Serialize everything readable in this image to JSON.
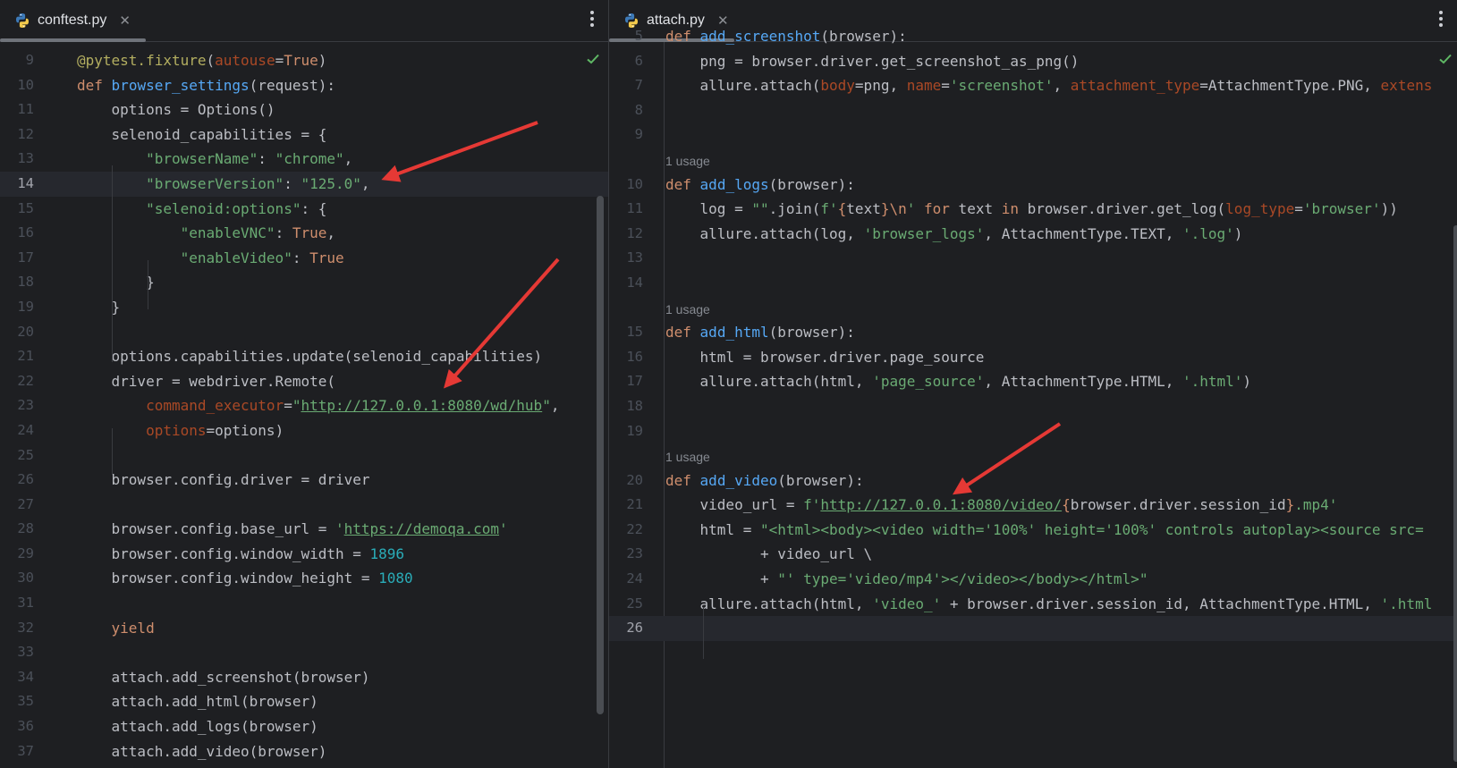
{
  "left_pane": {
    "tab": {
      "label": "conftest.py",
      "close": "✕"
    },
    "lines": [
      {
        "n": "9",
        "html": "<span class='dec'>@pytest.fixture</span>(<span class='ar'>autouse</span>=<span class='kw'>True</span>)"
      },
      {
        "n": "10",
        "html": "<span class='kw'>def</span> <span class='fn'>browser_settings</span>(request):"
      },
      {
        "n": "11",
        "html": "    options = Options()"
      },
      {
        "n": "12",
        "html": "    selenoid_capabilities = {"
      },
      {
        "n": "13",
        "html": "        <span class='st'>\"browserName\"</span>: <span class='st'>\"chrome\"</span>,"
      },
      {
        "n": "14",
        "html": "        <span class='st'>\"browserVersion\"</span>: <span class='st'>\"125.0\"</span>,",
        "current": true
      },
      {
        "n": "15",
        "html": "        <span class='st'>\"selenoid:options\"</span>: {"
      },
      {
        "n": "16",
        "html": "            <span class='st'>\"enableVNC\"</span>: <span class='kw'>True</span>,"
      },
      {
        "n": "17",
        "html": "            <span class='st'>\"enableVideo\"</span>: <span class='kw'>True</span>"
      },
      {
        "n": "18",
        "html": "        }"
      },
      {
        "n": "19",
        "html": "    }"
      },
      {
        "n": "20",
        "html": ""
      },
      {
        "n": "21",
        "html": "    options.capabilities.update(selenoid_capabilities)"
      },
      {
        "n": "22",
        "html": "    driver = webdriver.Remote("
      },
      {
        "n": "23",
        "html": "        <span class='ar'>command_executor</span>=<span class='st'>\"</span><span class='url'>http://127.0.0.1:8080/wd/hub</span><span class='st'>\"</span>,"
      },
      {
        "n": "24",
        "html": "        <span class='ar'>options</span>=options)"
      },
      {
        "n": "25",
        "html": ""
      },
      {
        "n": "26",
        "html": "    browser.config.driver = driver"
      },
      {
        "n": "27",
        "html": ""
      },
      {
        "n": "28",
        "html": "    browser.config.base_url = <span class='st'>'</span><span class='url'>https://demoqa.com</span><span class='st'>'</span>"
      },
      {
        "n": "29",
        "html": "    browser.config.window_width = <span class='nm'>1896</span>"
      },
      {
        "n": "30",
        "html": "    browser.config.window_height = <span class='nm'>1080</span>"
      },
      {
        "n": "31",
        "html": ""
      },
      {
        "n": "32",
        "html": "    <span class='kw'>yield</span>"
      },
      {
        "n": "33",
        "html": ""
      },
      {
        "n": "34",
        "html": "    attach.add_screenshot(browser)"
      },
      {
        "n": "35",
        "html": "    attach.add_html(browser)"
      },
      {
        "n": "36",
        "html": "    attach.add_logs(browser)"
      },
      {
        "n": "37",
        "html": "    attach.add_video(browser)"
      }
    ]
  },
  "right_pane": {
    "tab": {
      "label": "attach.py",
      "close": "✕"
    },
    "lines": [
      {
        "n": "5",
        "html": "<span class='kw'>def</span> <span class='fn'>add_screenshot</span>(browser):",
        "partial": true
      },
      {
        "n": "6",
        "html": "    png = browser.driver.get_screenshot_as_png()"
      },
      {
        "n": "7",
        "html": "    allure.attach(<span class='ar'>body</span>=png, <span class='ar'>name</span>=<span class='st'>'screenshot'</span>, <span class='ar'>attachment_type</span>=AttachmentType.PNG, <span class='ar'>extens</span>"
      },
      {
        "n": "8",
        "html": ""
      },
      {
        "n": "9",
        "html": ""
      },
      {
        "usage": "1 usage"
      },
      {
        "n": "10",
        "html": "<span class='kw'>def</span> <span class='fn'>add_logs</span>(browser):"
      },
      {
        "n": "11",
        "html": "    log = <span class='st'>\"\"</span>.join(<span class='st'>f'</span><span class='brc'>{</span>text<span class='brc'>}</span><span class='esc'>\\n</span><span class='st'>'</span> <span class='kw'>for</span> text <span class='kw'>in</span> browser.driver.get_log(<span class='ar'>log_type</span>=<span class='st'>'browser'</span>))"
      },
      {
        "n": "12",
        "html": "    allure.attach(log, <span class='st'>'browser_logs'</span>, AttachmentType.TEXT, <span class='st'>'.log'</span>)"
      },
      {
        "n": "13",
        "html": ""
      },
      {
        "n": "14",
        "html": ""
      },
      {
        "usage": "1 usage"
      },
      {
        "n": "15",
        "html": "<span class='kw'>def</span> <span class='fn'>add_html</span>(browser):"
      },
      {
        "n": "16",
        "html": "    html = browser.driver.page_source"
      },
      {
        "n": "17",
        "html": "    allure.attach(html, <span class='st'>'page_source'</span>, AttachmentType.HTML, <span class='st'>'.html'</span>)"
      },
      {
        "n": "18",
        "html": ""
      },
      {
        "n": "19",
        "html": ""
      },
      {
        "usage": "1 usage"
      },
      {
        "n": "20",
        "html": "<span class='kw'>def</span> <span class='fn'>add_video</span>(browser):"
      },
      {
        "n": "21",
        "html": "    video_url = <span class='st'>f'</span><span class='url'>http://127.0.0.1:8080/video/</span><span class='brc'>{</span>browser.driver.session_id<span class='brc'>}</span><span class='st'>.mp4'</span>"
      },
      {
        "n": "22",
        "html": "    html = <span class='st'>\"&lt;html&gt;&lt;body&gt;&lt;video width='100%' height='100%' controls autoplay&gt;&lt;source src=</span>"
      },
      {
        "n": "23",
        "html": "           + video_url \\"
      },
      {
        "n": "24",
        "html": "           + <span class='st'>\"' type='video/mp4'&gt;&lt;/video&gt;&lt;/body&gt;&lt;/html&gt;\"</span>"
      },
      {
        "n": "25",
        "html": "    allure.attach(html, <span class='st'>'video_'</span> + browser.driver.session_id, AttachmentType.HTML, <span class='st'>'.html</span>"
      },
      {
        "n": "26",
        "html": "",
        "current": true
      }
    ]
  },
  "colors": {
    "background": "#1e1f22",
    "accent_arrow": "#e53935",
    "check": "#5fb865"
  },
  "icons": [
    "python-file-icon",
    "close-icon",
    "more-options-icon",
    "inspection-ok-icon"
  ]
}
